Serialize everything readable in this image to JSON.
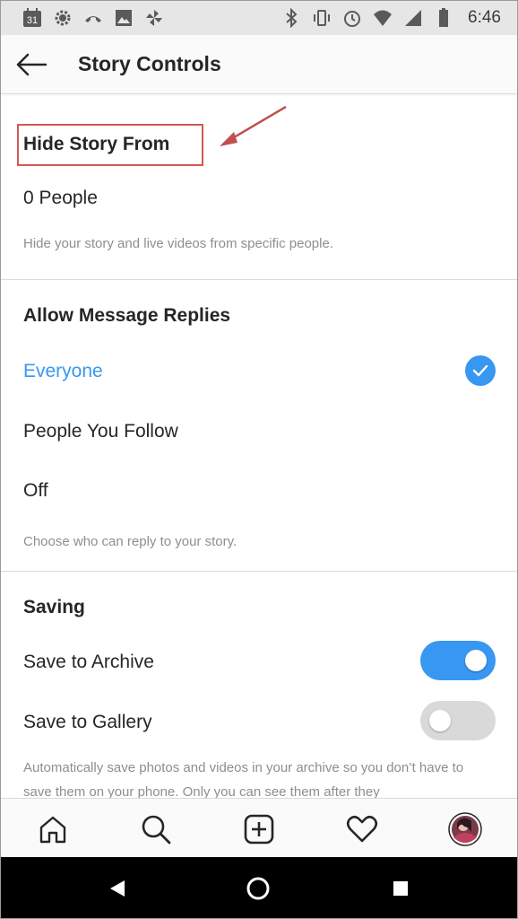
{
  "status_bar": {
    "calendar_day": "31",
    "time": "6:46",
    "left_icons": [
      "calendar-icon",
      "settings-gear-icon",
      "missed-call-icon",
      "image-icon",
      "pinwheel-icon"
    ],
    "right_icons": [
      "bluetooth-icon",
      "vibrate-icon",
      "alarm-icon",
      "wifi-icon",
      "signal-icon",
      "battery-icon"
    ]
  },
  "header": {
    "back_icon": "back-arrow-icon",
    "title": "Story Controls"
  },
  "hide_story": {
    "heading": "Hide Story From",
    "value": "0 People",
    "help": "Hide your story and live videos from specific people.",
    "highlight_color": "#d05a52"
  },
  "message_replies": {
    "heading": "Allow Message Replies",
    "options": [
      {
        "label": "Everyone",
        "selected": true
      },
      {
        "label": "People You Follow",
        "selected": false
      },
      {
        "label": "Off",
        "selected": false
      }
    ],
    "help": "Choose who can reply to your story."
  },
  "saving": {
    "heading": "Saving",
    "items": [
      {
        "label": "Save to Archive",
        "enabled": true
      },
      {
        "label": "Save to Gallery",
        "enabled": false
      }
    ],
    "help": "Automatically save photos and videos in your archive so you don’t have to save them on your phone. Only you can see them after they"
  },
  "tabbar": {
    "tabs": [
      "home-icon",
      "search-icon",
      "new-post-icon",
      "activity-heart-icon",
      "profile-avatar"
    ]
  },
  "navbar": {
    "buttons": [
      "back-triangle-icon",
      "home-circle-icon",
      "recents-square-icon"
    ]
  },
  "colors": {
    "accent": "#3897f0",
    "text": "#262626",
    "muted": "#8e8e8e",
    "divider": "#dbdbdb",
    "toggle_off": "#d9d9d9"
  }
}
